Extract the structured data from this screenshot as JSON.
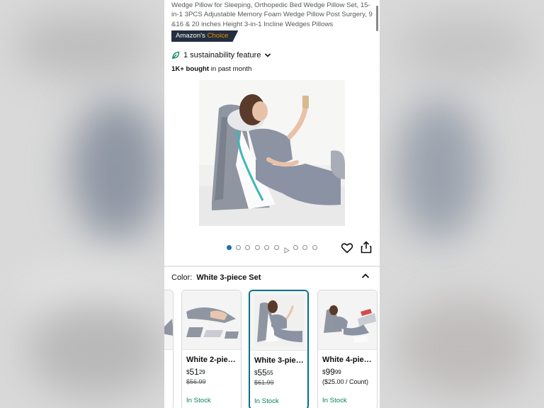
{
  "product": {
    "title": "Wedge Pillow for Sleeping, Orthopedic Bed Wedge Pillow Set, 15-in-1 3PCS Adjustable Memory Foam Wedge Pillow Post Surgery, 9 &16 & 20 inches Height 3-in-1 Incline Wedges Pillows",
    "badge_prefix": "Amazon's",
    "badge_suffix": "Choice",
    "sustainability": "1 sustainability feature",
    "bought_bold": "1K+ bought",
    "bought_rest": " in past month"
  },
  "gallery": {
    "image_count": 9,
    "active_index": 0,
    "video_index": 6
  },
  "variation": {
    "label": "Color:",
    "selected": "White 3-piece Set"
  },
  "cards": [
    {
      "name": "White 2-pie…",
      "currency": "$",
      "dollars": "51",
      "cents": "29",
      "sub": "$56.99",
      "stock": "In Stock"
    },
    {
      "name": "White 3-pie…",
      "currency": "$",
      "dollars": "55",
      "cents": "55",
      "sub": "$61.99",
      "stock": "In Stock"
    },
    {
      "name": "White 4-pie…",
      "currency": "$",
      "dollars": "99",
      "cents": "99",
      "sub": "($25.00 / Count)",
      "stock": "In Stock"
    }
  ],
  "colors": {
    "accent_teal": "#007185",
    "in_stock": "#067d62",
    "dot_active": "#1f6fb2",
    "badge_bg": "#232f3e",
    "badge_orange": "#f08804"
  }
}
